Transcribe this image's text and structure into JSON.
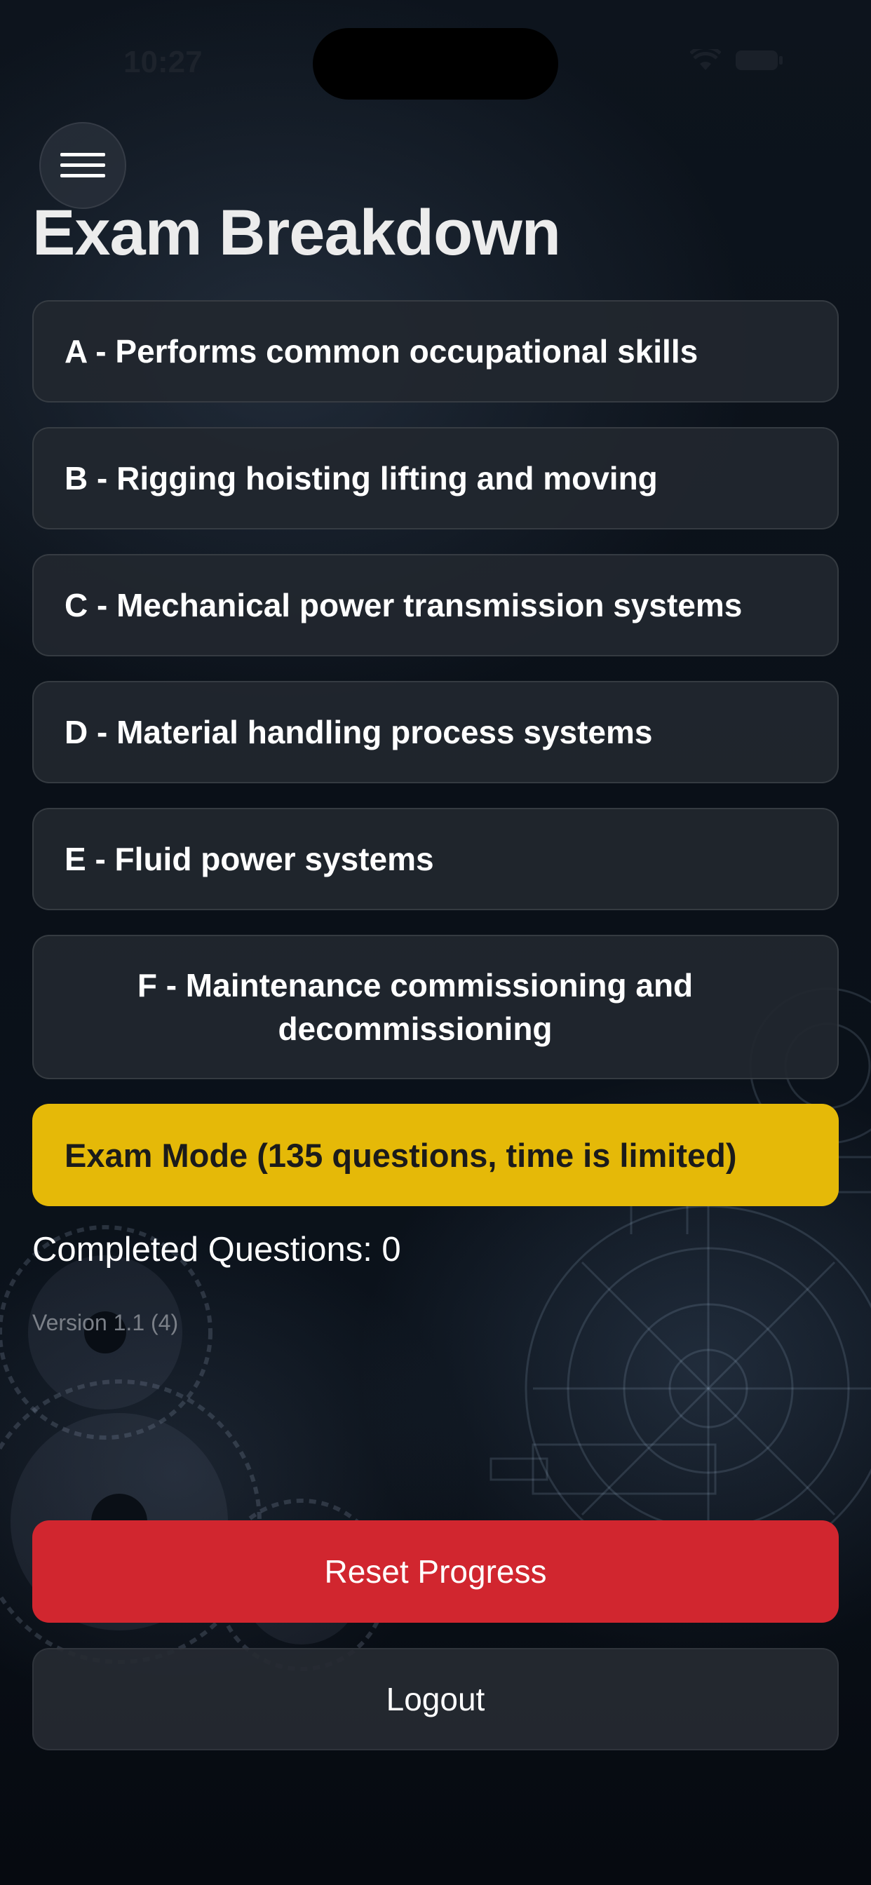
{
  "status_bar": {
    "time": "10:27"
  },
  "header": {
    "menu_icon": "hamburger-menu-icon",
    "title": "Exam Breakdown"
  },
  "sections": [
    {
      "label": "A - Performs common occupational skills"
    },
    {
      "label": "B - Rigging hoisting lifting and moving"
    },
    {
      "label": "C - Mechanical power transmission systems"
    },
    {
      "label": "D - Material handling process systems"
    },
    {
      "label": "E - Fluid power systems"
    },
    {
      "label": "F - Maintenance commissioning and decommissioning"
    }
  ],
  "exam_mode": {
    "label": "Exam Mode (135 questions, time is limited)"
  },
  "progress": {
    "completed_text": "Completed Questions: 0"
  },
  "version": "Version 1.1 (4)",
  "actions": {
    "reset_label": "Reset Progress",
    "logout_label": "Logout"
  },
  "colors": {
    "exam_mode": "#e5b908",
    "reset": "#d1262f",
    "card": "#22272f",
    "background": "#0a1018"
  }
}
